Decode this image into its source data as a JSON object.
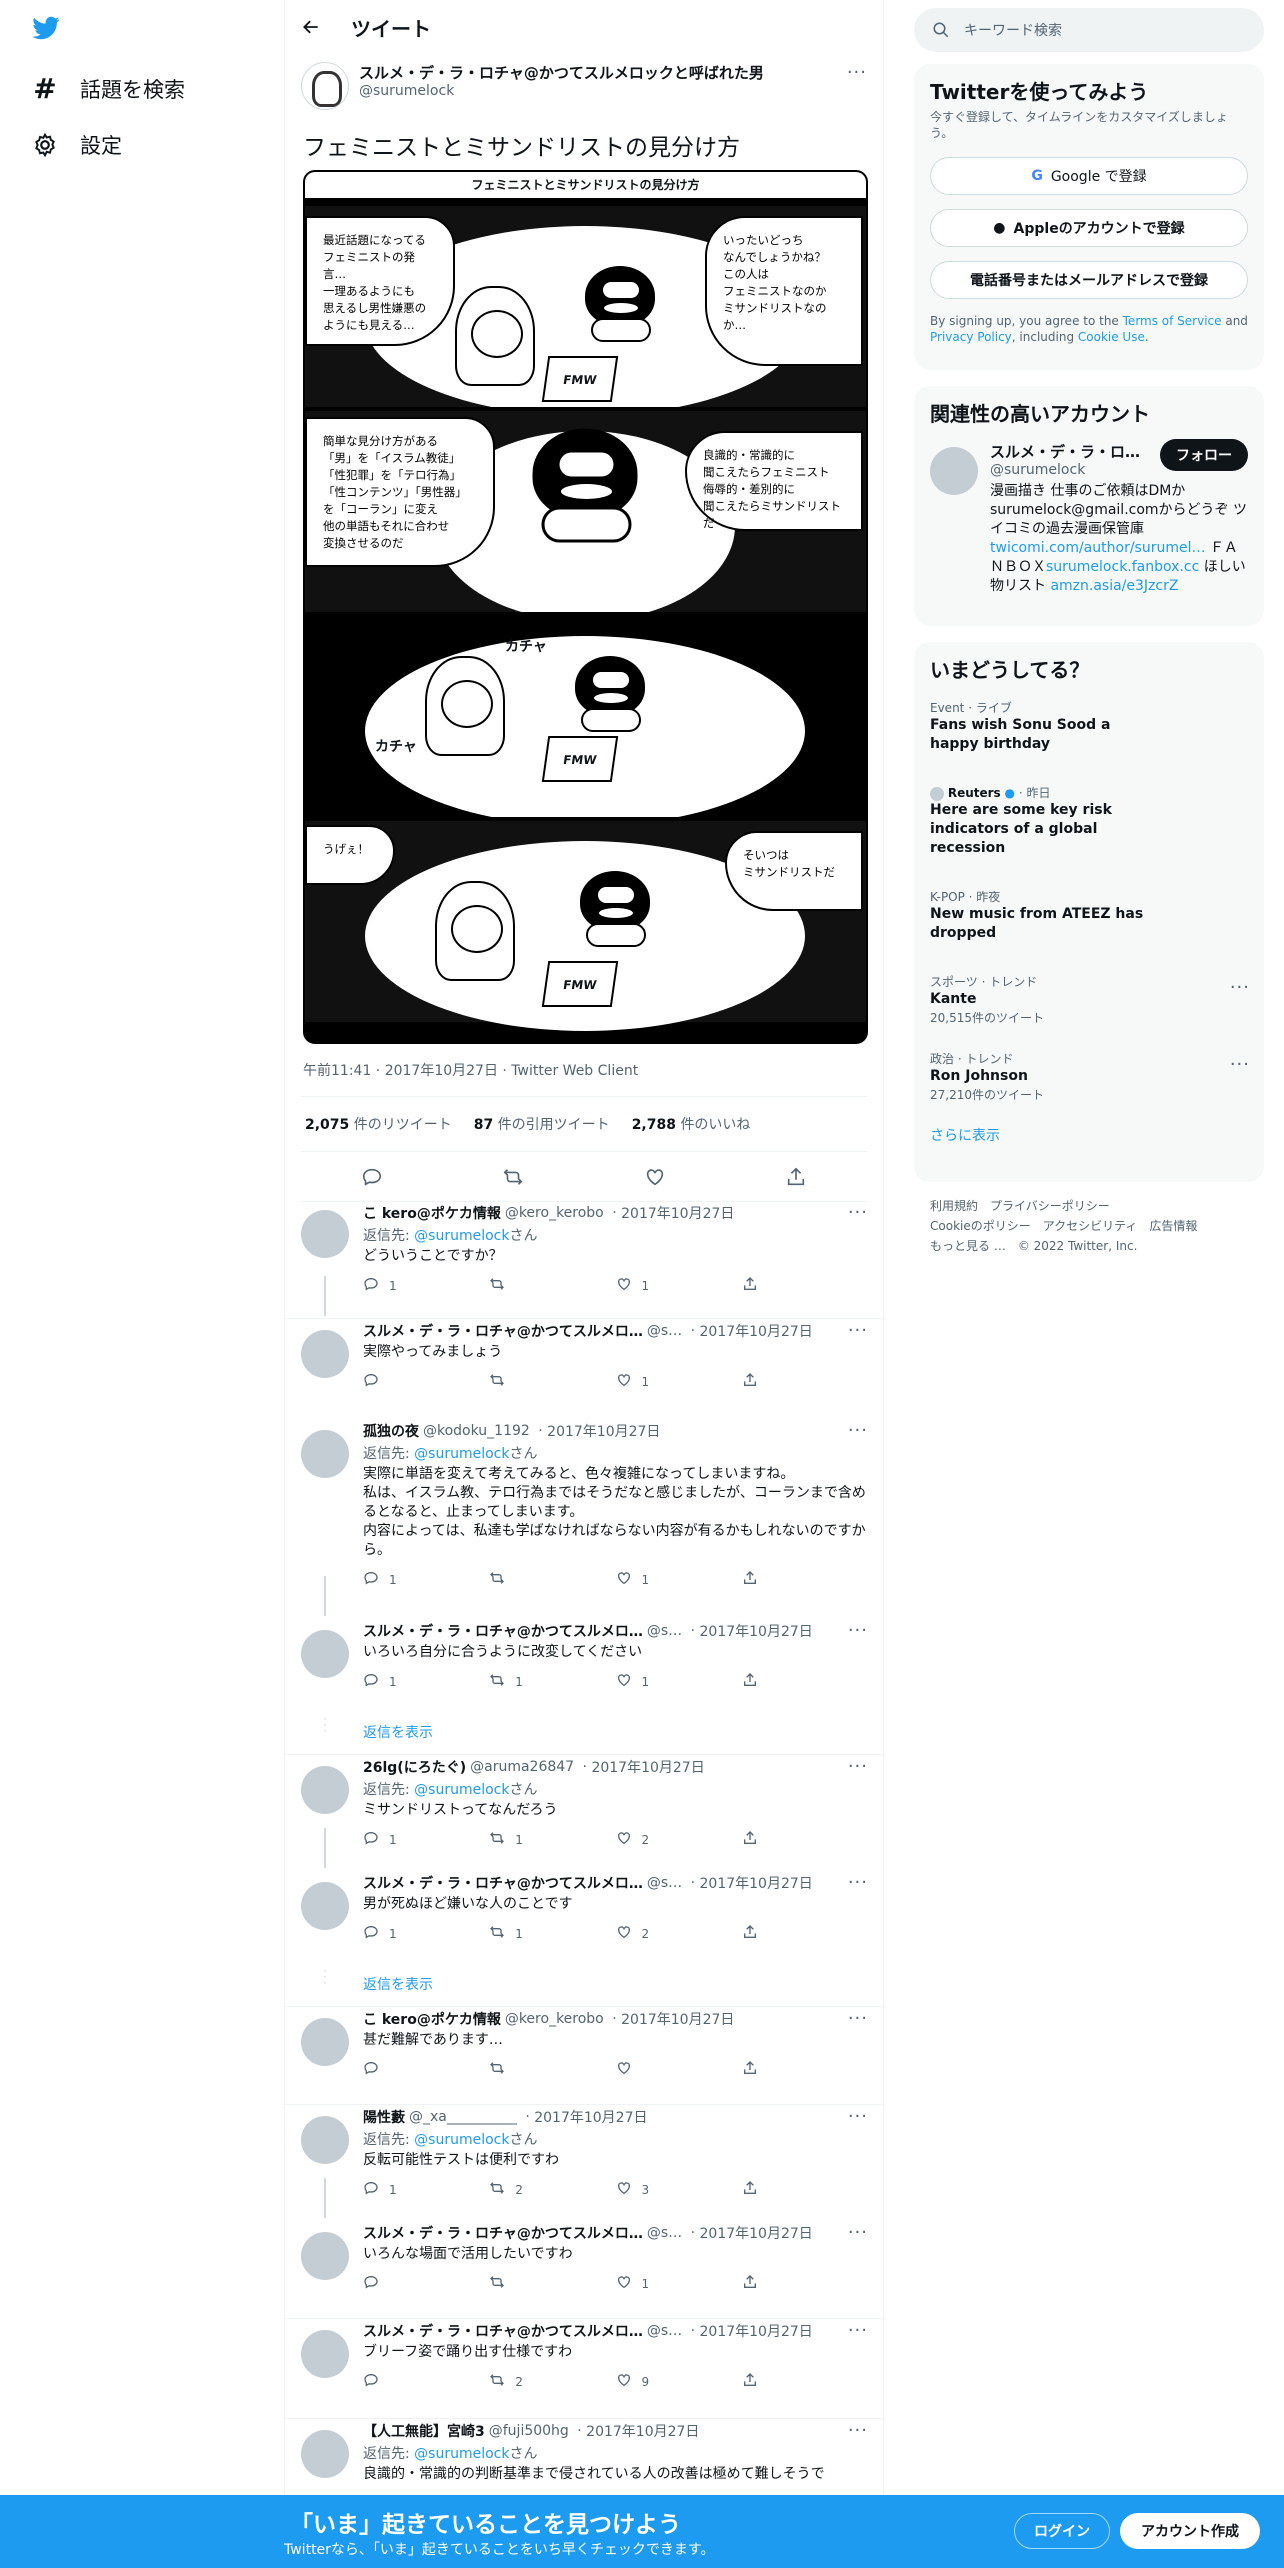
{
  "nav": {
    "explore": "話題を検索",
    "settings": "設定"
  },
  "header": {
    "title": "ツイート"
  },
  "tweet": {
    "author_name": "スルメ・デ・ラ・ロチャ@かつてスルメロックと呼ばれた男",
    "author_handle": "@surumelock",
    "text": "フェミニストとミサンドリストの見分け方",
    "meta": "午前11:41 · 2017年10月27日 · Twitter Web Client",
    "retweets": "2,075",
    "retweets_label": "件のリツイート",
    "quotes": "87",
    "quotes_label": "件の引用ツイート",
    "likes": "2,788",
    "likes_label": "件のいいね"
  },
  "comic": {
    "title": "フェミニストとミサンドリストの見分け方",
    "p1_left": "最近話題になってる\nフェミニストの発言…\n一理あるようにも\n思えるし男性嫌悪の\nようにも見える…",
    "p1_right": "いったいどっち\nなんでしょうかね？\nこの人は\nフェミニストなのか\nミサンドリストなのか…",
    "p2_left": "簡単な見分け方がある\n「男」を「イスラム教徒」\n「性犯罪」を「テロ行為」\n「性コンテンツ」「男性器」\nを「コーラン」に変え\n他の単語もそれに合わせ\n変換させるのだ",
    "p2_right": "良識的・常識的に\n聞こえたらフェミニスト\n侮辱的・差別的に\n聞こえたらミサンドリストだ",
    "p3_sfx1": "カチャ",
    "p3_sfx2": "カチャ",
    "p4_left": "うげぇ！",
    "p4_right": "そいつは\nミサンドリストだ",
    "laptop": "FMW"
  },
  "replies": [
    {
      "name": "こ kero@ポケカ情報",
      "handle": "@kero_kerobo",
      "date": "2017年10月27日",
      "reply_to": "@surumelock",
      "reply_prefix": "返信先: ",
      "reply_suffix": "さん",
      "text": "どういうことですか？",
      "replies": "1",
      "retweets": "",
      "likes": "1"
    },
    {
      "name": "スルメ・デ・ラ・ロチャ@かつてスルメロ…",
      "handle": "@s…",
      "date": "2017年10月27日",
      "text": "実際やってみましょう",
      "replies": "",
      "retweets": "",
      "likes": "1"
    },
    {
      "name": "孤独の夜",
      "handle": "@kodoku_1192",
      "date": "2017年10月27日",
      "reply_to": "@surumelock",
      "reply_prefix": "返信先: ",
      "reply_suffix": "さん",
      "text": "実際に単語を変えて考えてみると、色々複雑になってしまいますね。\n私は、イスラム教、テロ行為まではそうだなと感じましたが、コーランまで含めるとなると、止まってしまいます。\n内容によっては、私達も学ばなければならない内容が有るかもしれないのですから。",
      "replies": "1",
      "retweets": "",
      "likes": "1"
    },
    {
      "name": "スルメ・デ・ラ・ロチャ@かつてスルメロ…",
      "handle": "@s…",
      "date": "2017年10月27日",
      "text": "いろいろ自分に合うように改変してください",
      "replies": "1",
      "retweets": "1",
      "likes": "1"
    },
    {
      "name": "26lg(にろたぐ)",
      "handle": "@aruma26847",
      "date": "2017年10月27日",
      "reply_to": "@surumelock",
      "reply_prefix": "返信先: ",
      "reply_suffix": "さん",
      "text": "ミサンドリストってなんだろう",
      "replies": "1",
      "retweets": "1",
      "likes": "2"
    },
    {
      "name": "スルメ・デ・ラ・ロチャ@かつてスルメロ…",
      "handle": "@s…",
      "date": "2017年10月27日",
      "text": "男が死ぬほど嫌いな人のことです",
      "replies": "1",
      "retweets": "1",
      "likes": "2"
    },
    {
      "name": "こ kero@ポケカ情報",
      "handle": "@kero_kerobo",
      "date": "2017年10月27日",
      "text": "甚だ難解であります…",
      "replies": "",
      "retweets": "",
      "likes": ""
    },
    {
      "name": "陽性藪",
      "handle": "@_xa__________",
      "date": "2017年10月27日",
      "reply_to": "@surumelock",
      "reply_prefix": "返信先: ",
      "reply_suffix": "さん",
      "text": "反転可能性テストは便利ですわ",
      "replies": "1",
      "retweets": "2",
      "likes": "3"
    },
    {
      "name": "スルメ・デ・ラ・ロチャ@かつてスルメロ…",
      "handle": "@s…",
      "date": "2017年10月27日",
      "text": "いろんな場面で活用したいですわ",
      "replies": "",
      "retweets": "",
      "likes": "1"
    },
    {
      "name": "スルメ・デ・ラ・ロチャ@かつてスルメロ…",
      "handle": "@s…",
      "date": "2017年10月27日",
      "text": "ブリーフ姿で踊り出す仕様ですわ",
      "replies": "",
      "retweets": "2",
      "likes": "9"
    },
    {
      "name": "【人工無能】宮崎3",
      "handle": "@fuji500hg",
      "date": "2017年10月27日",
      "reply_to": "@surumelock",
      "reply_prefix": "返信先: ",
      "reply_suffix": "さん",
      "text": "良識的・常識的の判断基準まで侵されている人の改善は極めて難しそうで",
      "replies": "",
      "retweets": "",
      "likes": ""
    }
  ],
  "show_replies": "返信を表示",
  "search": {
    "placeholder": "キーワード検索"
  },
  "signup": {
    "title": "Twitterを使ってみよう",
    "sub": "今すぐ登録して、タイムラインをカスタマイズしましょう。",
    "google": "Google で登録",
    "apple": "Appleのアカウントで登録",
    "phone": "電話番号またはメールアドレスで登録",
    "legal_1": "By signing up, you agree to the ",
    "terms": "Terms of Service",
    "legal_2": " and ",
    "privacy": "Privacy Policy",
    "legal_3": ", including ",
    "cookie": "Cookie Use",
    "legal_4": "."
  },
  "related": {
    "title": "関連性の高いアカウント",
    "name": "スルメ・デ・ラ・ロ…",
    "handle": "@surumelock",
    "follow": "フォロー",
    "bio_1": "漫画描き 仕事のご依頼はDMか surumelock@gmail.comからどうぞ ツイコミの過去漫画保管庫 ",
    "bio_link1": "twicomi.com/author/surumel…",
    "bio_2": " ＦＡＮＢＯＸ",
    "bio_link2": "surumelock.fanbox.cc",
    "bio_3": " ほしい物リスト ",
    "bio_link3": "amzn.asia/e3JzcrZ"
  },
  "trends": {
    "title": "いまどうしてる？",
    "items": [
      {
        "cat": "Event · ライブ",
        "name": "Fans wish Sonu Sood a happy birthday"
      },
      {
        "source": "Reuters",
        "cat": "· 昨日",
        "name": "Here are some key risk indicators of a global recession"
      },
      {
        "cat": "K-POP · 昨夜",
        "name": "New music from ATEEZ has dropped"
      },
      {
        "cat": "スポーツ · トレンド",
        "name": "Kante",
        "count": "20,515件のツイート"
      },
      {
        "cat": "政治 · トレンド",
        "name": "Ron Johnson",
        "count": "27,210件のツイート"
      }
    ],
    "more": "さらに表示"
  },
  "footer": {
    "line1": "利用規約　プライバシーポリシー",
    "line2": "Cookieのポリシー　アクセシビリティ　広告情報",
    "line3": "もっと見る …　© 2022 Twitter, Inc."
  },
  "bottom": {
    "big": "「いま」起きていることを見つけよう",
    "small": "Twitterなら、「いま」起きていることをいち早くチェックできます。",
    "login": "ログイン",
    "signup": "アカウント作成"
  }
}
